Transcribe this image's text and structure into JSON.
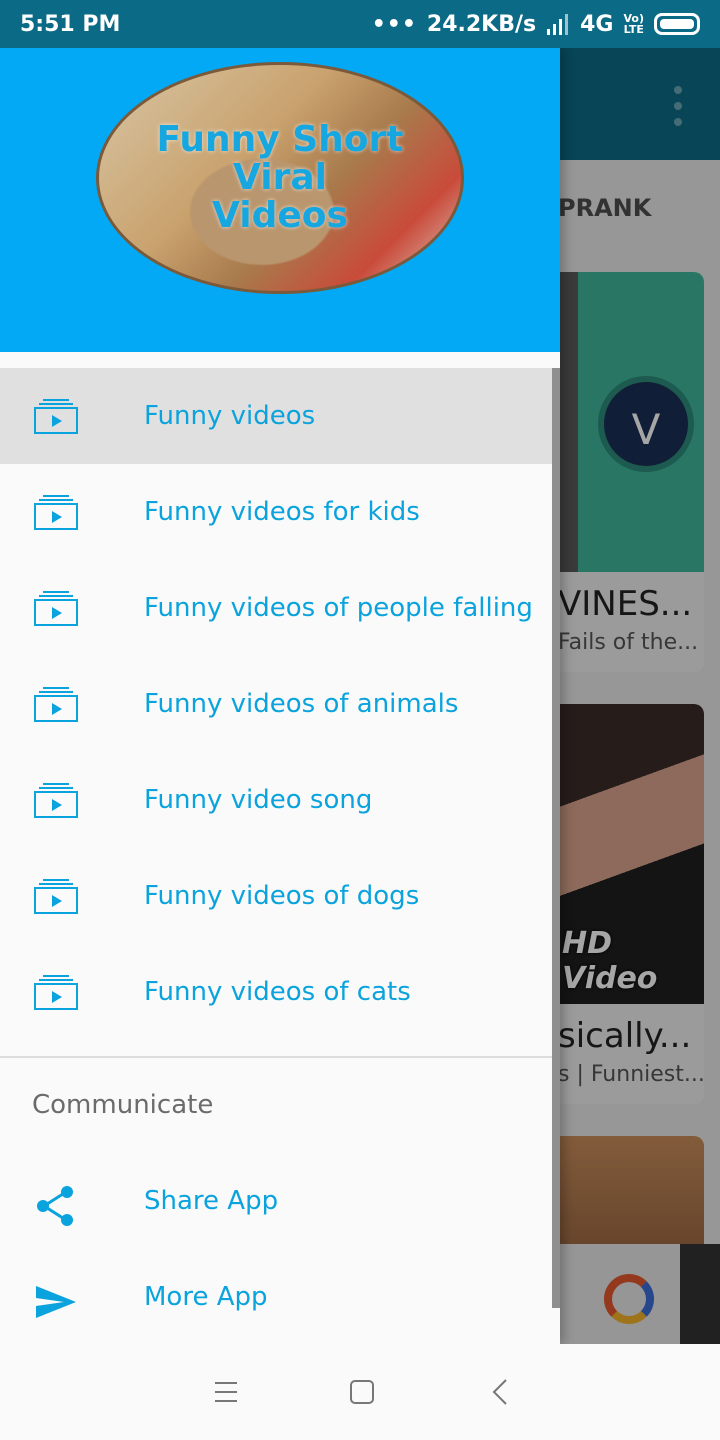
{
  "status_bar": {
    "time": "5:51 PM",
    "dots": "•••",
    "network_speed": "24.2KB/s",
    "network_type": "4G",
    "lte_top": "Vo)",
    "lte_bottom": "LTE"
  },
  "background": {
    "tab_label": "PRANK",
    "cards": [
      {
        "title": "VINES...",
        "subtitle": "Fails of the...",
        "badge": "V"
      },
      {
        "title": "sically...",
        "subtitle": "s | Funniest...",
        "thumb_label": "HD Video"
      }
    ]
  },
  "drawer": {
    "header_logo_lines": [
      "Funny Short",
      "Viral",
      "Videos"
    ],
    "menu_items": [
      {
        "label": "Funny videos",
        "active": true
      },
      {
        "label": "Funny videos for kids",
        "active": false
      },
      {
        "label": "Funny videos of people falling",
        "active": false
      },
      {
        "label": "Funny videos of animals",
        "active": false
      },
      {
        "label": "Funny video song",
        "active": false
      },
      {
        "label": "Funny videos of dogs",
        "active": false
      },
      {
        "label": "Funny videos of cats",
        "active": false
      }
    ],
    "section_title": "Communicate",
    "share_label": "Share App",
    "more_label": "More App"
  },
  "colors": {
    "accent": "#03a9f4",
    "menu_text": "#0aa3dd",
    "toolbar": "#0b6a86",
    "active_row": "#e0e0e0"
  },
  "icons": {
    "menu_item": "video-library-icon",
    "share": "share-icon",
    "more": "send-icon",
    "nav_menu": "recents-icon",
    "nav_home": "home-icon",
    "nav_back": "back-icon"
  }
}
